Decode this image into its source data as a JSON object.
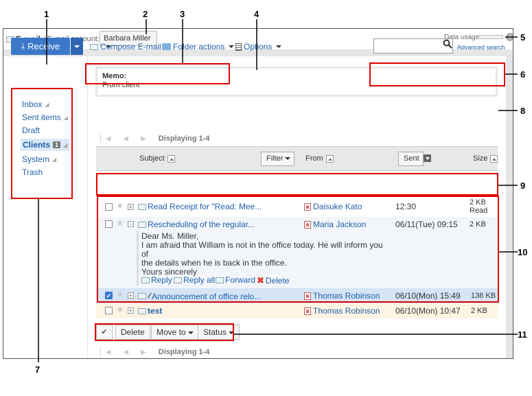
{
  "header": {
    "app_title": "E-mail",
    "account_label": "E-mail account:",
    "account_value": "Barbara Miller",
    "data_usage_label": "Data usage"
  },
  "toolbar": {
    "receive": "Receive",
    "compose": "Compose E-mail",
    "folder_actions": "Folder actions",
    "options": "Options",
    "search_placeholder": "",
    "advanced_search": "Advanced search"
  },
  "sidebar": {
    "items": [
      {
        "label": "Inbox",
        "rss": true
      },
      {
        "label": "Sent items",
        "rss": true
      },
      {
        "label": "Draft",
        "rss": false
      },
      {
        "label": "Clients",
        "rss": true,
        "count": "1",
        "selected": true
      },
      {
        "label": "System",
        "rss": true
      },
      {
        "label": "Trash",
        "rss": false
      }
    ]
  },
  "memo": {
    "title": "Memo:",
    "text": "From client"
  },
  "pager": {
    "displaying": "Displaying 1-4"
  },
  "actions": {
    "delete": "Delete",
    "move_to": "Move to",
    "status": "Status"
  },
  "table": {
    "subject_header": "Subject",
    "filter": "Filter",
    "from_header": "From",
    "sent_header": "Sent",
    "size_header": "Size",
    "rows": [
      {
        "subject": "Read Receipt for \"Read: Mee...",
        "from": "Daisuke Kato",
        "sent": "12:30",
        "size": "2 KB",
        "size2": "Read",
        "checked": false,
        "expanded": false,
        "bold": false
      },
      {
        "subject": "Rescheduling of the regular...",
        "from": "Maria Jackson",
        "sent": "06/11(Tue) 09:15",
        "size": "2 KB",
        "checked": false,
        "expanded": true,
        "bold": false
      },
      {
        "subject": "Announcement of office relo...",
        "from": "Thomas Robinson",
        "sent": "06/10(Mon) 15:49",
        "size": "136 KB",
        "checked": true,
        "expanded": false,
        "bold": false
      },
      {
        "subject": "test",
        "from": "Thomas Robinson",
        "sent": "06/10(Mon) 10:47",
        "size": "2 KB",
        "checked": false,
        "expanded": false,
        "bold": true
      }
    ]
  },
  "preview": {
    "lines": [
      "Dear Ms. Miller,",
      "I am afraid that William is not in the office today. He will inform you of",
      "the details when he is back in the office.",
      "Yours sincerely"
    ],
    "reply": "Reply",
    "reply_all": "Reply all",
    "forward": "Forward",
    "delete": "Delete"
  },
  "callouts": [
    "1",
    "2",
    "3",
    "4",
    "5",
    "6",
    "7",
    "8",
    "9",
    "10",
    "11"
  ],
  "colors": {
    "accent": "#3b78c9",
    "link": "#1e5fa8",
    "callout": "#e00000",
    "selected_row": "#dbe8f7",
    "unread_row": "#fdf4e3"
  }
}
